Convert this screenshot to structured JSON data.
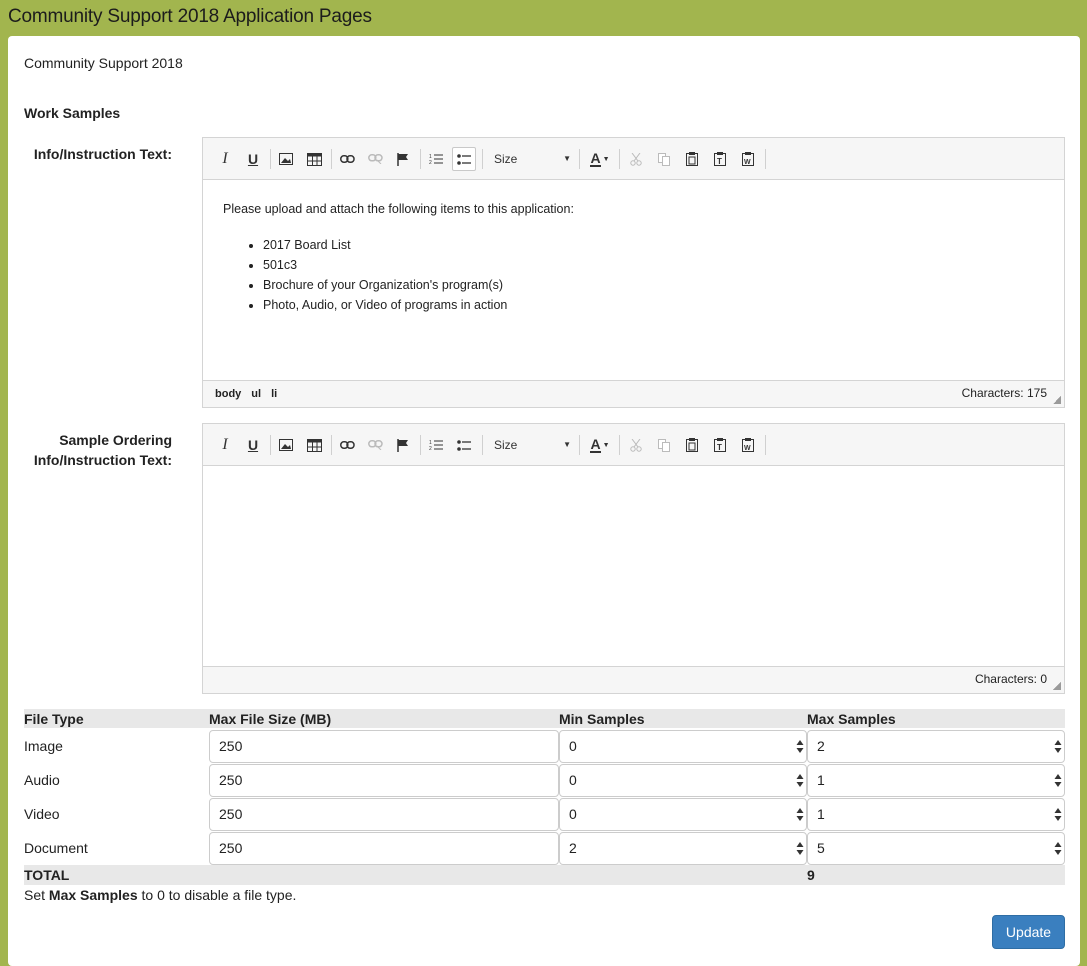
{
  "page": {
    "title": "Community Support 2018 Application Pages",
    "subtitle": "Community Support 2018",
    "section": "Work Samples"
  },
  "editor1": {
    "label": "Info/Instruction Text:",
    "intro": "Please upload and attach the following items to this application:",
    "items": [
      "2017 Board List",
      "501c3",
      "Brochure of your Organization's program(s)",
      "Photo, Audio, or Video of programs in action"
    ],
    "path": [
      "body",
      "ul",
      "li"
    ],
    "chars": "Characters: 175",
    "size_label": "Size"
  },
  "editor2": {
    "label_line1": "Sample Ordering",
    "label_line2": "Info/Instruction Text:",
    "chars": "Characters: 0",
    "size_label": "Size"
  },
  "toolbar_icons": [
    "italic-icon",
    "underline-icon",
    "image-icon",
    "table-icon",
    "link-icon",
    "unlink-icon",
    "flag-icon",
    "ordered-list-icon",
    "bullet-list-icon",
    "font-color-icon",
    "cut-icon",
    "copy-icon",
    "paste-icon",
    "paste-text-icon",
    "paste-word-icon"
  ],
  "toolbar_glyphs": {
    "italic": "I",
    "underline": "U",
    "color": "A"
  },
  "file_table": {
    "headers": [
      "File Type",
      "Max File Size (MB)",
      "Min Samples",
      "Max Samples"
    ],
    "rows": [
      {
        "type": "Image",
        "max_size": "250",
        "min": "0",
        "max": "2"
      },
      {
        "type": "Audio",
        "max_size": "250",
        "min": "0",
        "max": "1"
      },
      {
        "type": "Video",
        "max_size": "250",
        "min": "0",
        "max": "1"
      },
      {
        "type": "Document",
        "max_size": "250",
        "min": "2",
        "max": "5"
      }
    ],
    "total_label": "TOTAL",
    "total_value": "9"
  },
  "note": {
    "prefix": "Set ",
    "bold": "Max Samples",
    "suffix": " to 0 to disable a file type."
  },
  "update_label": "Update",
  "colors": {
    "header_bg": "#a2b54e",
    "button_bg": "#3a7fbf"
  }
}
